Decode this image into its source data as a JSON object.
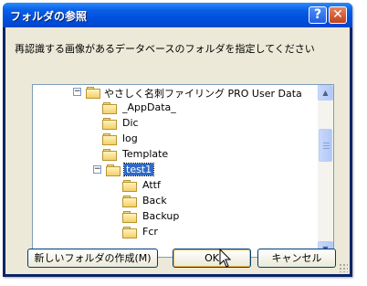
{
  "window": {
    "title": "フォルダの参照",
    "help_label": "?",
    "close_label": "✕"
  },
  "dialog": {
    "prompt": "再認識する画像があるデータベースのフォルダを指定してください"
  },
  "tree": {
    "items": [
      {
        "label": "やさしく名刺ファイリング PRO User Data",
        "expander": "⊟"
      },
      {
        "label": "_AppData_"
      },
      {
        "label": "Dic"
      },
      {
        "label": "log"
      },
      {
        "label": "Template"
      },
      {
        "label": "test1",
        "expander": "⊟",
        "selected": true
      },
      {
        "label": "Attf"
      },
      {
        "label": "Back"
      },
      {
        "label": "Backup"
      },
      {
        "label": "Fcr"
      }
    ]
  },
  "buttons": {
    "new_folder": "新しいフォルダの作成(M)",
    "ok": "OK",
    "cancel": "キャンセル"
  },
  "icons": {
    "folder": "folder-icon",
    "scroll_up": "▲",
    "scroll_down": "▼"
  }
}
